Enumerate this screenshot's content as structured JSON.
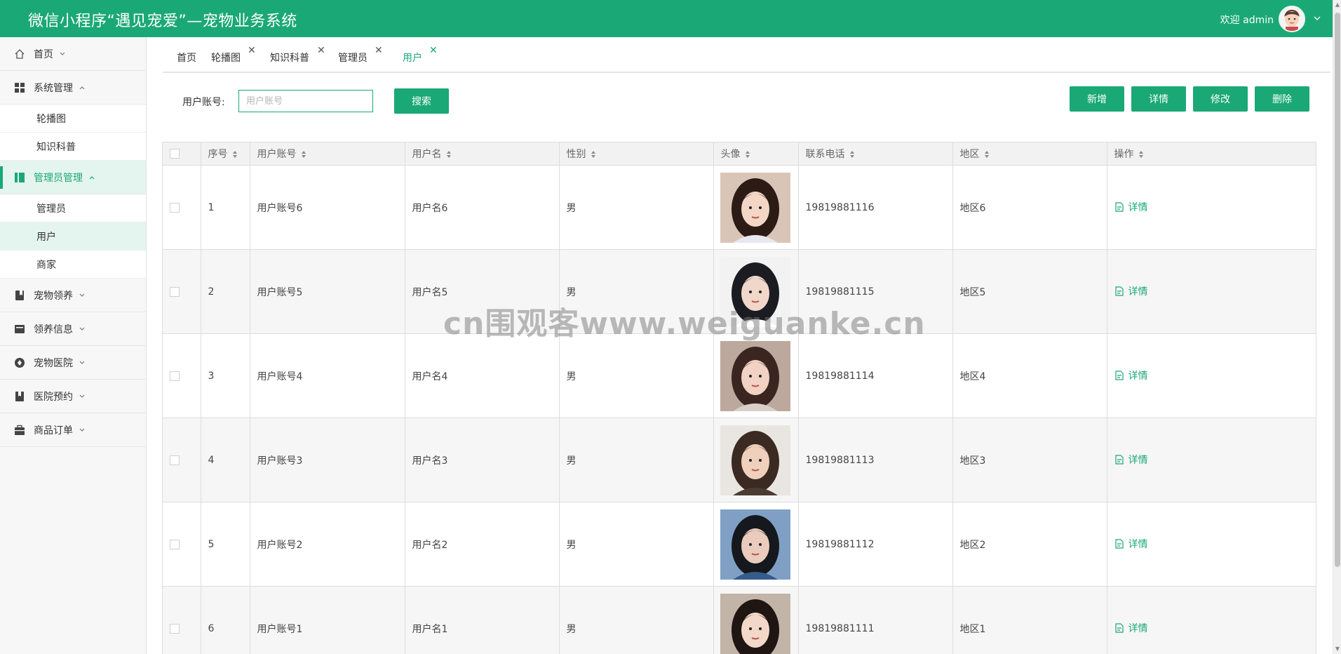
{
  "header": {
    "title": "微信小程序“遇见宠爱”—宠物业务系统",
    "welcome": "欢迎 admin"
  },
  "sidebar": {
    "items": [
      {
        "label": "首页",
        "icon": "home-icon",
        "expanded": false
      },
      {
        "label": "系统管理",
        "icon": "grid-icon",
        "expanded": true,
        "children": [
          "轮播图",
          "知识科普"
        ]
      },
      {
        "label": "管理员管理",
        "icon": "admin-icon",
        "expanded": true,
        "active": true,
        "children": [
          "管理员",
          "用户",
          "商家"
        ]
      },
      {
        "label": "宠物领养",
        "icon": "book-icon",
        "expanded": false
      },
      {
        "label": "领养信息",
        "icon": "card-icon",
        "expanded": false
      },
      {
        "label": "宠物医院",
        "icon": "hospital-icon",
        "expanded": false
      },
      {
        "label": "医院预约",
        "icon": "bookmark-icon",
        "expanded": false
      },
      {
        "label": "商品订单",
        "icon": "briefcase-icon",
        "expanded": false
      }
    ],
    "selected_sub": "用户"
  },
  "tabs": [
    {
      "label": "首页",
      "closable": false
    },
    {
      "label": "轮播图",
      "closable": true
    },
    {
      "label": "知识科普",
      "closable": true
    },
    {
      "label": "管理员",
      "closable": true
    },
    {
      "label": "用户",
      "closable": true,
      "current": true
    }
  ],
  "search": {
    "label": "用户账号:",
    "placeholder": "用户账号",
    "value": "",
    "button": "搜索"
  },
  "actions": [
    "新增",
    "详情",
    "修改",
    "删除"
  ],
  "table": {
    "columns": [
      "序号",
      "用户账号",
      "用户名",
      "性别",
      "头像",
      "联系电话",
      "地区",
      "操作"
    ],
    "rows": [
      {
        "no": "1",
        "account": "用户账号6",
        "name": "用户名6",
        "gender": "男",
        "phone": "19819881116",
        "region": "地区6",
        "op": "详情"
      },
      {
        "no": "2",
        "account": "用户账号5",
        "name": "用户名5",
        "gender": "男",
        "phone": "19819881115",
        "region": "地区5",
        "op": "详情"
      },
      {
        "no": "3",
        "account": "用户账号4",
        "name": "用户名4",
        "gender": "男",
        "phone": "19819881114",
        "region": "地区4",
        "op": "详情"
      },
      {
        "no": "4",
        "account": "用户账号3",
        "name": "用户名3",
        "gender": "男",
        "phone": "19819881113",
        "region": "地区3",
        "op": "详情"
      },
      {
        "no": "5",
        "account": "用户账号2",
        "name": "用户名2",
        "gender": "男",
        "phone": "19819881112",
        "region": "地区2",
        "op": "详情"
      },
      {
        "no": "6",
        "account": "用户账号1",
        "name": "用户名1",
        "gender": "男",
        "phone": "19819881111",
        "region": "地区1",
        "op": "详情"
      }
    ]
  },
  "watermark": "cn围观客www.weiguanke.cn",
  "colors": {
    "accent": "#1aa876",
    "active_bg": "#e4f4ee"
  }
}
